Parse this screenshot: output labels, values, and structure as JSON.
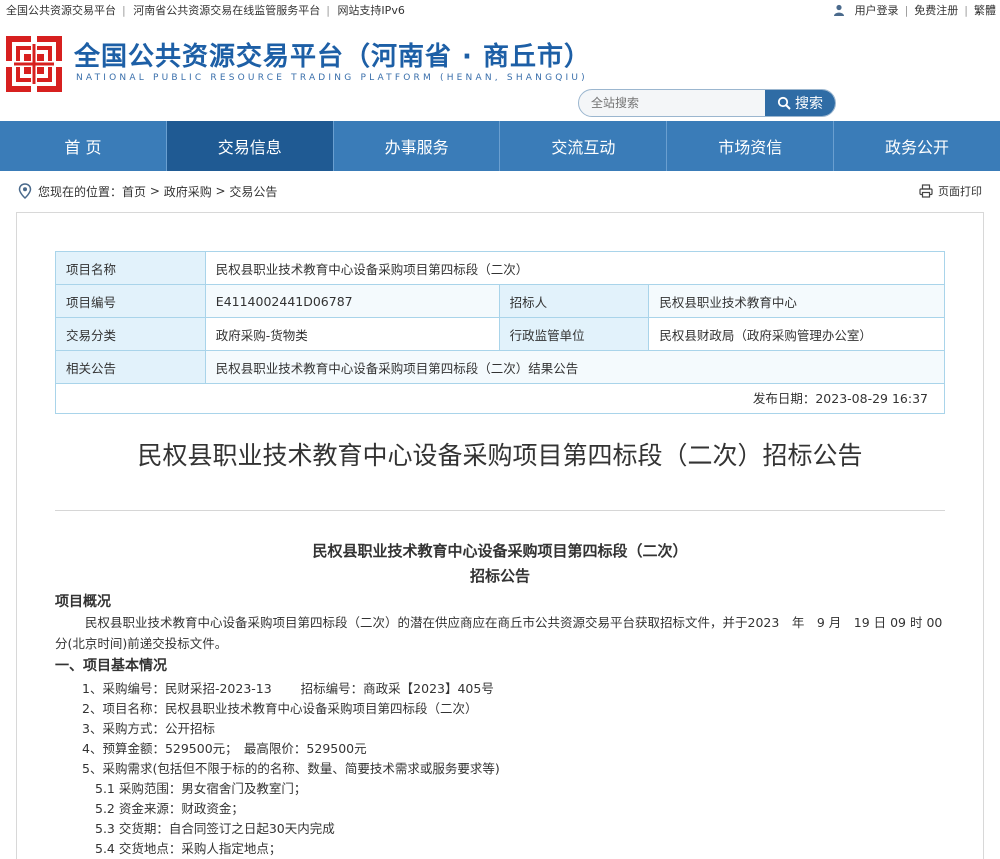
{
  "topbar": {
    "links": [
      "全国公共资源交易平台",
      "河南省公共资源交易在线监管服务平台",
      "网站支持IPv6"
    ],
    "login": "用户登录",
    "register": "免费注册",
    "traditional": "繁體"
  },
  "header": {
    "title": "全国公共资源交易平台（河南省 · 商丘市）",
    "subtitle": "NATIONAL PUBLIC RESOURCE TRADING PLATFORM (HENAN, SHANGQIU)",
    "search_placeholder": "全站搜索",
    "search_button": "搜索"
  },
  "nav": [
    "首  页",
    "交易信息",
    "办事服务",
    "交流互动",
    "市场资信",
    "政务公开"
  ],
  "nav_active_index": 1,
  "breadcrumb": {
    "prefix": "您现在的位置：",
    "items": [
      "首页",
      "政府采购",
      "交易公告"
    ],
    "print": "页面打印"
  },
  "info": {
    "project_name_label": "项目名称",
    "project_name": "民权县职业技术教育中心设备采购项目第四标段（二次）",
    "project_no_label": "项目编号",
    "project_no": "E4114002441D06787",
    "tenderer_label": "招标人",
    "tenderer": "民权县职业技术教育中心",
    "category_label": "交易分类",
    "category": "政府采购-货物类",
    "supervisor_label": "行政监管单位",
    "supervisor": "民权县财政局（政府采购管理办公室）",
    "related_label": "相关公告",
    "related": "民权县职业技术教育中心设备采购项目第四标段（二次）结果公告",
    "publish": "发布日期：2023-08-29 16:37"
  },
  "main_title": "民权县职业技术教育中心设备采购项目第四标段（二次）招标公告",
  "doc": {
    "title_line1": "民权县职业技术教育中心设备采购项目第四标段（二次）",
    "title_line2": "招标公告",
    "overview_heading": "项目概况",
    "overview_text": "民权县职业技术教育中心设备采购项目第四标段（二次）的潜在供应商应在商丘市公共资源交易平台获取招标文件，并于2023　年　9 月　19 日 09 时 00 分(北京时间)前递交投标文件。",
    "section1_heading": "一、项目基本情况",
    "items": [
      "1、采购编号：民财采招-2023-13　　 招标编号：商政采【2023】405号",
      "2、项目名称：民权县职业技术教育中心设备采购项目第四标段（二次）",
      "3、采购方式：公开招标",
      "4、预算金额：529500元；　最高限价：529500元",
      "5、采购需求(包括但不限于标的的名称、数量、简要技术需求或服务要求等)"
    ],
    "subitems": [
      "5.1 采购范围：男女宿舍门及教室门；",
      "5.2 资金来源：财政资金；",
      "5.3 交货期：自合同签订之日起30天内完成",
      "5.4 交货地点：采购人指定地点；"
    ]
  },
  "colors": {
    "brand_blue": "#1d5fa6",
    "nav_bg": "#3a7cb8",
    "nav_active": "#1f5a93",
    "logo_red": "#d7201f",
    "table_border": "#a9d4ea",
    "table_label_bg": "#e2f2fb"
  }
}
